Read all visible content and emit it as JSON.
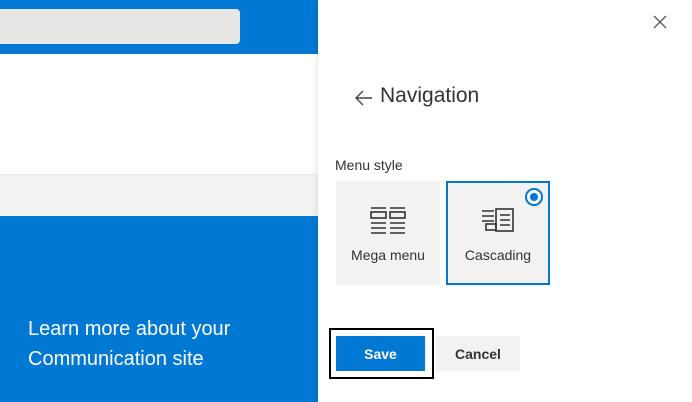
{
  "background": {
    "hero_text": "Learn more about your Communication site"
  },
  "panel": {
    "title": "Navigation",
    "menu_style_label": "Menu style",
    "options": [
      {
        "label": "Mega menu",
        "icon": "mega-menu-icon",
        "selected": false
      },
      {
        "label": "Cascading",
        "icon": "cascading-icon",
        "selected": true
      }
    ],
    "save_label": "Save",
    "cancel_label": "Cancel"
  },
  "colors": {
    "accent": "#0078d4",
    "button_gray": "#f3f2f1"
  }
}
